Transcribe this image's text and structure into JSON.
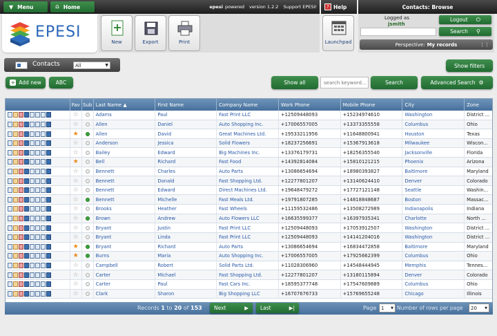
{
  "topbar": {
    "menu": "Menu",
    "home": "Home",
    "app_name": "epesi",
    "powered": "powered",
    "version": "version 1.2.2",
    "support": "Support EPESI!",
    "help": "Help",
    "title": "Contacts: Browse"
  },
  "logo": {
    "text": "EPESI"
  },
  "actions": {
    "new": "New",
    "export": "Export",
    "print": "Print",
    "launchpad": "Launchpad"
  },
  "user": {
    "logged_as": "Logged as",
    "username": "jsmith",
    "logout": "Logout",
    "search": "Search",
    "perspective_label": "Perspective:",
    "perspective_value": "My records"
  },
  "contacts_bar": {
    "label": "Contacts",
    "filter_value": "All",
    "show_filters": "Show filters"
  },
  "controls": {
    "add_new": "Add new",
    "abc": "ABC",
    "show_all": "Show all",
    "search_placeholder": "search keyword...",
    "search": "Search",
    "advanced_search": "Advanced Search"
  },
  "grid": {
    "columns": [
      "",
      "Fav",
      "Sub",
      "Last Name ▲",
      "First Name",
      "Company Name",
      "Work Phone",
      "Mobile Phone",
      "City",
      "Zone"
    ],
    "rows": [
      {
        "fav": false,
        "sub": false,
        "last": "Adams",
        "first": "Paul",
        "company": "Fast Print LLC",
        "work": "+12509448093",
        "mobile": "+15234974610",
        "city": "Washington",
        "zone": "District ..."
      },
      {
        "fav": false,
        "sub": false,
        "last": "Allen",
        "first": "Daniel",
        "company": "Auto Shopping Inc.",
        "work": "+17006557005",
        "mobile": "+13373355558",
        "city": "Columbus",
        "zone": "Ohio"
      },
      {
        "fav": true,
        "sub": true,
        "last": "Allen",
        "first": "David",
        "company": "Great Machines Ltd.",
        "work": "+19533211956",
        "mobile": "+11648800941",
        "city": "Houston",
        "zone": "Texas"
      },
      {
        "fav": false,
        "sub": false,
        "last": "Anderson",
        "first": "Jessica",
        "company": "Solid Flowers",
        "work": "+18237256691",
        "mobile": "+15367913618",
        "city": "Milwaukee",
        "zone": "Wiscon..."
      },
      {
        "fav": false,
        "sub": false,
        "last": "Bailey",
        "first": "Edward",
        "company": "Big Machines Inc.",
        "work": "+13376179731",
        "mobile": "+18256355540",
        "city": "Jacksonville",
        "zone": "Florida"
      },
      {
        "fav": true,
        "sub": false,
        "last": "Bell",
        "first": "Richard",
        "company": "Fast Food",
        "work": "+14392814084",
        "mobile": "+15810121215",
        "city": "Phoenix",
        "zone": "Arizona"
      },
      {
        "fav": false,
        "sub": false,
        "last": "Bennett",
        "first": "Charles",
        "company": "Auto Parts",
        "work": "+13086654694",
        "mobile": "+18980393827",
        "city": "Baltimore",
        "zone": "Maryland"
      },
      {
        "fav": false,
        "sub": false,
        "last": "Bennett",
        "first": "Donald",
        "company": "Fast Shopping Ltd.",
        "work": "+12277801207",
        "mobile": "+13140624410",
        "city": "Denver",
        "zone": "Colorado"
      },
      {
        "fav": false,
        "sub": false,
        "last": "Bennett",
        "first": "Edward",
        "company": "Direct Machines Ltd.",
        "work": "+19648479272",
        "mobile": "+17727121148",
        "city": "Seattle",
        "zone": "Washin..."
      },
      {
        "fav": false,
        "sub": true,
        "last": "Bennett",
        "first": "Michelle",
        "company": "Fast Meals Ltd.",
        "work": "+19791807285",
        "mobile": "+14818848687",
        "city": "Boston",
        "zone": "Massac..."
      },
      {
        "fav": false,
        "sub": false,
        "last": "Brooks",
        "first": "Heather",
        "company": "Fast Wheels",
        "work": "+11159532486",
        "mobile": "+13508272989",
        "city": "Indianapolis",
        "zone": "Indiana"
      },
      {
        "fav": false,
        "sub": true,
        "last": "Brown",
        "first": "Andrew",
        "company": "Auto Flowers LLC",
        "work": "+16635599377",
        "mobile": "+16397935341",
        "city": "Charlotte",
        "zone": "North ..."
      },
      {
        "fav": false,
        "sub": false,
        "last": "Bryant",
        "first": "Justin",
        "company": "Fast Print LLC",
        "work": "+12509448093",
        "mobile": "+17053912507",
        "city": "Washington",
        "zone": "District ..."
      },
      {
        "fav": false,
        "sub": false,
        "last": "Bryant",
        "first": "Linda",
        "company": "Fast Print LLC",
        "work": "+12509448093",
        "mobile": "+14141204016",
        "city": "Washington",
        "zone": "District ..."
      },
      {
        "fav": true,
        "sub": true,
        "last": "Bryant",
        "first": "Richard",
        "company": "Auto Parts",
        "work": "+13086654694",
        "mobile": "+16834472858",
        "city": "Baltimore",
        "zone": "Maryland"
      },
      {
        "fav": true,
        "sub": true,
        "last": "Burns",
        "first": "Maria",
        "company": "Auto Shopping Inc.",
        "work": "+17006557005",
        "mobile": "+17925662399",
        "city": "Columbus",
        "zone": "Ohio"
      },
      {
        "fav": false,
        "sub": false,
        "last": "Campbell",
        "first": "Robert",
        "company": "Solid Parts Ltd.",
        "work": "+11028306960",
        "mobile": "+14548444945",
        "city": "Memphis",
        "zone": "Tennes..."
      },
      {
        "fav": false,
        "sub": false,
        "last": "Carter",
        "first": "Michael",
        "company": "Fast Shopping Ltd.",
        "work": "+12277801207",
        "mobile": "+13180115894",
        "city": "Denver",
        "zone": "Colorado"
      },
      {
        "fav": false,
        "sub": false,
        "last": "Carter",
        "first": "Paul",
        "company": "Fast Cars Inc.",
        "work": "+18595377748",
        "mobile": "+17547609889",
        "city": "Columbus",
        "zone": "Ohio"
      },
      {
        "fav": false,
        "sub": false,
        "last": "Clark",
        "first": "Sharon",
        "company": "Big Shopping LLC",
        "work": "+16707676733",
        "mobile": "+15769655248",
        "city": "Chicago",
        "zone": "Illinois"
      }
    ]
  },
  "footer": {
    "records_label": "Records",
    "from": "1",
    "to_label": "to",
    "to": "20",
    "of_label": "of",
    "total": "153",
    "next": "Next",
    "last": "Last",
    "page_label": "Page",
    "page_value": "1",
    "rows_label": "Number of rows per page",
    "rows_value": "20"
  }
}
